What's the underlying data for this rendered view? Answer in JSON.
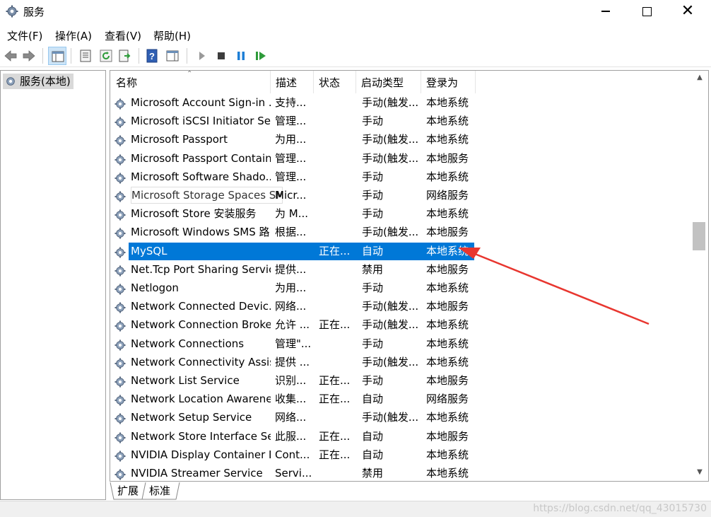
{
  "window": {
    "title": "服务",
    "icon": "services-gear-icon",
    "controls": [
      "minimize",
      "maximize",
      "close"
    ]
  },
  "menu": [
    "文件(F)",
    "操作(A)",
    "查看(V)",
    "帮助(H)"
  ],
  "toolbar": [
    "back-arrow-icon",
    "forward-arrow-icon",
    "show-console-tree-icon",
    "properties-icon",
    "refresh-icon",
    "export-list-icon",
    "help-icon",
    "view-pane-icon",
    "start-service-icon",
    "stop-service-icon",
    "pause-service-icon",
    "restart-service-icon"
  ],
  "tree": {
    "node_label": "服务(本地)"
  },
  "columns": {
    "name": "名称",
    "desc": "描述",
    "status": "状态",
    "startup": "启动类型",
    "logon": "登录为"
  },
  "rows": [
    {
      "name": "Microsoft Account Sign-in ...",
      "desc": "支持...",
      "status": "",
      "startup": "手动(触发...",
      "logon": "本地系统"
    },
    {
      "name": "Microsoft iSCSI Initiator Ser...",
      "desc": "管理...",
      "status": "",
      "startup": "手动",
      "logon": "本地系统"
    },
    {
      "name": "Microsoft Passport",
      "desc": "为用...",
      "status": "",
      "startup": "手动(触发...",
      "logon": "本地系统"
    },
    {
      "name": "Microsoft Passport Container",
      "desc": "管理...",
      "status": "",
      "startup": "手动(触发...",
      "logon": "本地服务"
    },
    {
      "name": "Microsoft Software Shado...",
      "desc": "管理...",
      "status": "",
      "startup": "手动",
      "logon": "本地系统"
    },
    {
      "name": "Microsoft Storage Spaces SMP",
      "desc": "Micr...",
      "status": "",
      "startup": "手动",
      "logon": "网络服务"
    },
    {
      "name": "Microsoft Store 安装服务",
      "desc": "为 M...",
      "status": "",
      "startup": "手动",
      "logon": "本地系统"
    },
    {
      "name": "Microsoft Windows SMS 路...",
      "desc": "根据...",
      "status": "",
      "startup": "手动(触发...",
      "logon": "本地服务"
    },
    {
      "name": "MySQL",
      "desc": "",
      "status": "正在...",
      "startup": "自动",
      "logon": "本地系统"
    },
    {
      "name": "Net.Tcp Port Sharing Service",
      "desc": "提供...",
      "status": "",
      "startup": "禁用",
      "logon": "本地服务"
    },
    {
      "name": "Netlogon",
      "desc": "为用...",
      "status": "",
      "startup": "手动",
      "logon": "本地系统"
    },
    {
      "name": "Network Connected Devic...",
      "desc": "网络...",
      "status": "",
      "startup": "手动(触发...",
      "logon": "本地服务"
    },
    {
      "name": "Network Connection Broker",
      "desc": "允许 ...",
      "status": "正在...",
      "startup": "手动(触发...",
      "logon": "本地系统"
    },
    {
      "name": "Network Connections",
      "desc": "管理\"...",
      "status": "",
      "startup": "手动",
      "logon": "本地系统"
    },
    {
      "name": "Network Connectivity Assis...",
      "desc": "提供 ...",
      "status": "",
      "startup": "手动(触发...",
      "logon": "本地系统"
    },
    {
      "name": "Network List Service",
      "desc": "识别...",
      "status": "正在...",
      "startup": "手动",
      "logon": "本地服务"
    },
    {
      "name": "Network Location Awarene...",
      "desc": "收集...",
      "status": "正在...",
      "startup": "自动",
      "logon": "网络服务"
    },
    {
      "name": "Network Setup Service",
      "desc": "网络...",
      "status": "",
      "startup": "手动(触发...",
      "logon": "本地系统"
    },
    {
      "name": "Network Store Interface Se...",
      "desc": "此服...",
      "status": "正在...",
      "startup": "自动",
      "logon": "本地服务"
    },
    {
      "name": "NVIDIA Display Container LS",
      "desc": "Cont...",
      "status": "正在...",
      "startup": "自动",
      "logon": "本地系统"
    },
    {
      "name": "NVIDIA Streamer Service",
      "desc": "Servi...",
      "status": "",
      "startup": "禁用",
      "logon": "本地系统"
    }
  ],
  "selected_row_index": 8,
  "tabs": [
    "扩展",
    "标准"
  ],
  "watermark": "https://blog.csdn.net/qq_43015730",
  "colors": {
    "selection": "#0078d7",
    "annotation_arrow": "#e8362f"
  }
}
